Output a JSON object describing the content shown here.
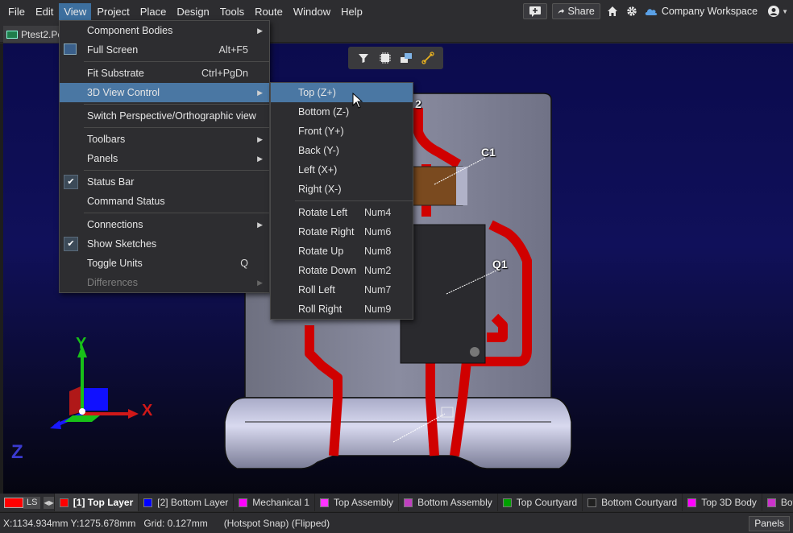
{
  "menubar": {
    "items": [
      "File",
      "Edit",
      "View",
      "Project",
      "Place",
      "Design",
      "Tools",
      "Route",
      "Window",
      "Help"
    ],
    "share_label": "Share",
    "workspace_label": "Company Workspace"
  },
  "doc_tab": {
    "label": "Ptest2.Pc"
  },
  "view_menu": {
    "component_bodies": "Component Bodies",
    "full_screen": "Full Screen",
    "full_screen_sc": "Alt+F5",
    "fit_substrate": "Fit Substrate",
    "fit_substrate_sc": "Ctrl+PgDn",
    "view_control": "3D View Control",
    "switch_persp": "Switch Perspective/Orthographic view",
    "toolbars": "Toolbars",
    "panels": "Panels",
    "status_bar": "Status Bar",
    "command_status": "Command Status",
    "connections": "Connections",
    "show_sketches": "Show Sketches",
    "toggle_units": "Toggle Units",
    "toggle_units_sc": "Q",
    "differences": "Differences"
  },
  "submenu": {
    "items": [
      {
        "label": "Top (Z+)",
        "sc": ""
      },
      {
        "label": "Bottom (Z-)",
        "sc": ""
      },
      {
        "label": "Front (Y+)",
        "sc": ""
      },
      {
        "label": "Back (Y-)",
        "sc": ""
      },
      {
        "label": "Left (X+)",
        "sc": ""
      },
      {
        "label": "Right (X-)",
        "sc": ""
      },
      {
        "label": "Rotate Left",
        "sc": "Num4"
      },
      {
        "label": "Rotate Right",
        "sc": "Num6"
      },
      {
        "label": "Rotate Up",
        "sc": "Num8"
      },
      {
        "label": "Rotate Down",
        "sc": "Num2"
      },
      {
        "label": "Roll Left",
        "sc": "Num7"
      },
      {
        "label": "Roll Right",
        "sc": "Num9"
      }
    ]
  },
  "canvas": {
    "label_c1": "C1",
    "label_q1": "Q1",
    "label_2": "2",
    "axis_x": "X",
    "axis_y": "Y",
    "axis_z": "Z"
  },
  "layerbar": {
    "ls_label": "LS",
    "layers": [
      {
        "label": "[1] Top Layer",
        "color": "#ff0000"
      },
      {
        "label": "[2] Bottom Layer",
        "color": "#0000ff"
      },
      {
        "label": "Mechanical 1",
        "color": "#ff00ff"
      },
      {
        "label": "Top Assembly",
        "color": "#ff33ff"
      },
      {
        "label": "Bottom Assembly",
        "color": "#c040c0"
      },
      {
        "label": "Top Courtyard",
        "color": "#00a000"
      },
      {
        "label": "Bottom Courtyard",
        "color": "#202020"
      },
      {
        "label": "Top 3D Body",
        "color": "#ff00ff"
      },
      {
        "label": "Both",
        "color": "#cc33cc"
      }
    ]
  },
  "statusbar": {
    "coords": "X:1134.934mm Y:1275.678mm",
    "grid": "Grid: 0.127mm",
    "snap": "(Hotspot Snap) (Flipped)",
    "panels": "Panels"
  }
}
